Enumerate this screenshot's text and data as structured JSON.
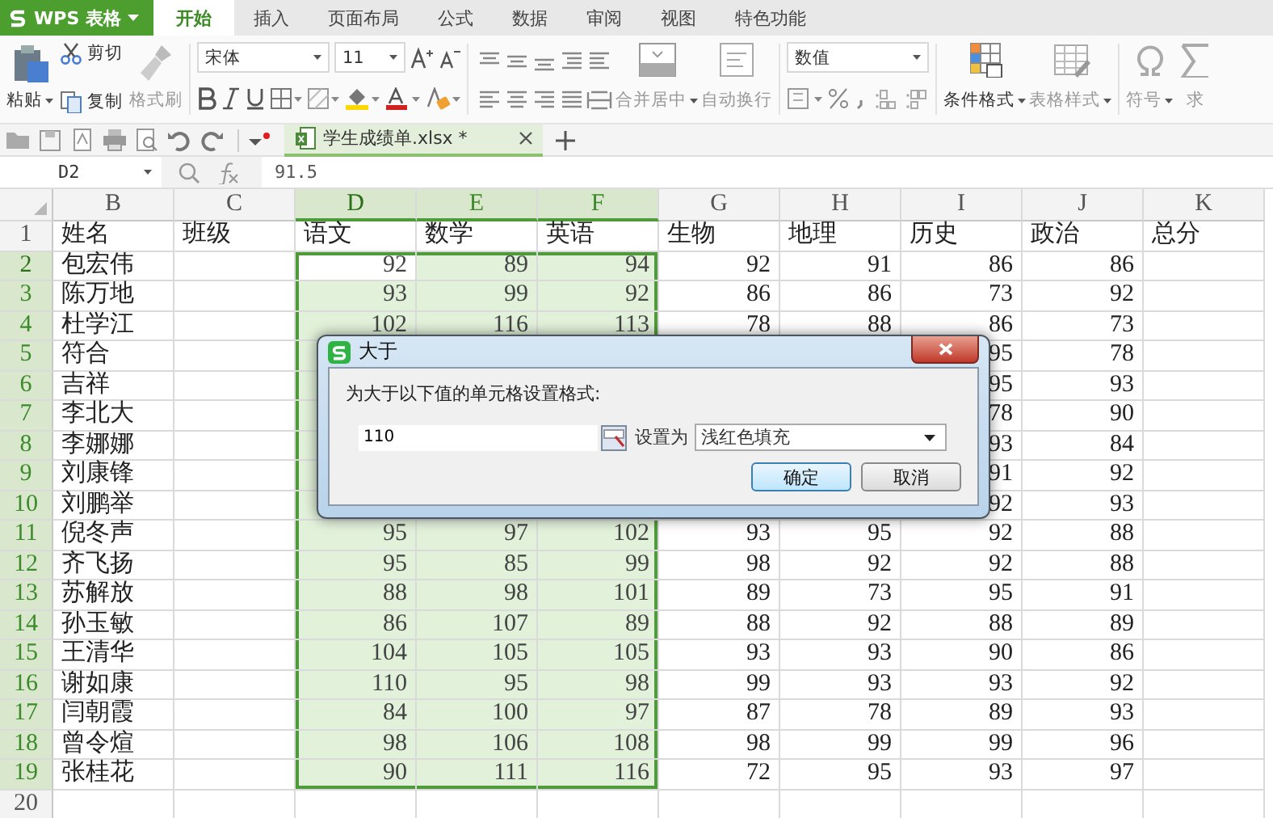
{
  "app_menu": {
    "label": "WPS 表格"
  },
  "tabs": [
    {
      "label": "开始",
      "selected": true
    },
    {
      "label": "插入",
      "selected": false
    },
    {
      "label": "页面布局",
      "selected": false
    },
    {
      "label": "公式",
      "selected": false
    },
    {
      "label": "数据",
      "selected": false
    },
    {
      "label": "审阅",
      "selected": false
    },
    {
      "label": "视图",
      "selected": false
    },
    {
      "label": "特色功能",
      "selected": false
    }
  ],
  "ribbon": {
    "paste": {
      "label": "粘贴"
    },
    "cut": {
      "label": "剪切"
    },
    "copy": {
      "label": "复制"
    },
    "format_painter": {
      "label": "格式刷",
      "disabled": true
    },
    "font_name": "宋体",
    "font_size": "11",
    "number_format": "数值",
    "alignment_buttons": [
      {
        "label": "合并居中",
        "kind": "merge",
        "disabled": true,
        "dropdown": true
      },
      {
        "label": "自动换行",
        "kind": "wrap",
        "disabled": true,
        "dropdown": false
      }
    ],
    "style_buttons": [
      {
        "label": "条件格式",
        "kind": "conditional",
        "disabled": false,
        "dropdown": true
      },
      {
        "label": "表格样式",
        "kind": "table",
        "disabled": true,
        "dropdown": true
      }
    ],
    "insert_buttons": [
      {
        "label": "符号",
        "kind": "symbol",
        "disabled": true,
        "dropdown": true
      },
      {
        "label": "求",
        "kind": "sum",
        "disabled": true,
        "dropdown": false
      }
    ]
  },
  "document_tab": {
    "title": "学生成绩单.xlsx *"
  },
  "formula_bar": {
    "name_box": "D2",
    "formula": "91.5"
  },
  "columns": [
    {
      "label": "B",
      "selected": false,
      "active": false
    },
    {
      "label": "C",
      "selected": false,
      "active": false
    },
    {
      "label": "D",
      "selected": true,
      "active": true
    },
    {
      "label": "E",
      "selected": true,
      "active": false
    },
    {
      "label": "F",
      "selected": true,
      "active": false
    },
    {
      "label": "G",
      "selected": false,
      "active": false
    },
    {
      "label": "H",
      "selected": false,
      "active": false
    },
    {
      "label": "I",
      "selected": false,
      "active": false
    },
    {
      "label": "J",
      "selected": false,
      "active": false
    },
    {
      "label": "K",
      "selected": false,
      "active": false
    }
  ],
  "rows": [
    {
      "number": "1",
      "selected": false,
      "active": false,
      "cells": [
        "姓名",
        "班级",
        "语文",
        "数学",
        "英语",
        "生物",
        "地理",
        "历史",
        "政治",
        "总分"
      ]
    },
    {
      "number": "2",
      "selected": true,
      "active": true,
      "cells": [
        "包宏伟",
        null,
        "92",
        "89",
        "94",
        "92",
        "91",
        "86",
        "86",
        null
      ]
    },
    {
      "number": "3",
      "selected": true,
      "active": false,
      "cells": [
        "陈万地",
        null,
        "93",
        "99",
        "92",
        "86",
        "86",
        "73",
        "92",
        null
      ]
    },
    {
      "number": "4",
      "selected": true,
      "active": false,
      "cells": [
        "杜学江",
        null,
        "102",
        "116",
        "113",
        "78",
        "88",
        "86",
        "73",
        null
      ]
    },
    {
      "number": "5",
      "selected": true,
      "active": false,
      "cells": [
        "符合",
        null,
        null,
        null,
        null,
        null,
        null,
        "95",
        "78",
        null
      ]
    },
    {
      "number": "6",
      "selected": true,
      "active": false,
      "cells": [
        "吉祥",
        null,
        null,
        null,
        null,
        null,
        null,
        "95",
        "93",
        null
      ]
    },
    {
      "number": "7",
      "selected": true,
      "active": false,
      "cells": [
        "李北大",
        null,
        null,
        null,
        null,
        null,
        null,
        "78",
        "90",
        null
      ]
    },
    {
      "number": "8",
      "selected": true,
      "active": false,
      "cells": [
        "李娜娜",
        null,
        null,
        null,
        null,
        null,
        null,
        "93",
        "84",
        null
      ]
    },
    {
      "number": "9",
      "selected": true,
      "active": false,
      "cells": [
        "刘康锋",
        null,
        null,
        null,
        null,
        null,
        null,
        "91",
        "92",
        null
      ]
    },
    {
      "number": "10",
      "selected": true,
      "active": false,
      "cells": [
        "刘鹏举",
        null,
        null,
        null,
        null,
        null,
        null,
        "92",
        "93",
        null
      ]
    },
    {
      "number": "11",
      "selected": true,
      "active": false,
      "cells": [
        "倪冬声",
        null,
        "95",
        "97",
        "102",
        "93",
        "95",
        "92",
        "88",
        null
      ]
    },
    {
      "number": "12",
      "selected": true,
      "active": false,
      "cells": [
        "齐飞扬",
        null,
        "95",
        "85",
        "99",
        "98",
        "92",
        "92",
        "88",
        null
      ]
    },
    {
      "number": "13",
      "selected": true,
      "active": false,
      "cells": [
        "苏解放",
        null,
        "88",
        "98",
        "101",
        "89",
        "73",
        "95",
        "91",
        null
      ]
    },
    {
      "number": "14",
      "selected": true,
      "active": false,
      "cells": [
        "孙玉敏",
        null,
        "86",
        "107",
        "89",
        "88",
        "92",
        "88",
        "89",
        null
      ]
    },
    {
      "number": "15",
      "selected": true,
      "active": false,
      "cells": [
        "王清华",
        null,
        "104",
        "105",
        "105",
        "93",
        "93",
        "90",
        "86",
        null
      ]
    },
    {
      "number": "16",
      "selected": true,
      "active": false,
      "cells": [
        "谢如康",
        null,
        "110",
        "95",
        "98",
        "99",
        "93",
        "93",
        "92",
        null
      ]
    },
    {
      "number": "17",
      "selected": true,
      "active": false,
      "cells": [
        "闫朝霞",
        null,
        "84",
        "100",
        "97",
        "87",
        "78",
        "89",
        "93",
        null
      ]
    },
    {
      "number": "18",
      "selected": true,
      "active": false,
      "cells": [
        "曾令煊",
        null,
        "98",
        "106",
        "108",
        "98",
        "99",
        "99",
        "96",
        null
      ]
    },
    {
      "number": "19",
      "selected": true,
      "active": false,
      "cells": [
        "张桂花",
        null,
        "90",
        "111",
        "116",
        "72",
        "95",
        "93",
        "97",
        null
      ]
    },
    {
      "number": "20",
      "selected": false,
      "active": false,
      "cells": [
        null,
        null,
        null,
        null,
        null,
        null,
        null,
        null,
        null,
        null
      ]
    }
  ],
  "dialog": {
    "title": "大于",
    "prompt": "为大于以下值的单元格设置格式:",
    "value": "110",
    "set_as_label": "设置为",
    "format": "浅红色填充",
    "ok": "确定",
    "cancel": "取消"
  }
}
